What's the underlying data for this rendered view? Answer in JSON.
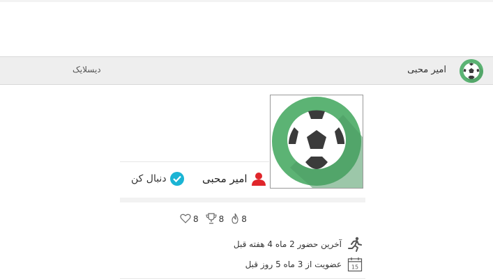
{
  "header": {
    "username": "امیر محبی",
    "dislike_label": "دیسلایک",
    "avatar_icon": "soccer-ball-icon"
  },
  "profile": {
    "name": "امیر محبی",
    "follow_label": "دنبال کن",
    "photo_icon": "soccer-ball-icon",
    "stats": {
      "likes": "8",
      "trophies": "8",
      "flames": "8"
    },
    "last_seen": "آخرین حضور 2 ماه 4 هفته قبل",
    "membership": "عضویت از 3 ماه 5 روز قبل",
    "calendar_day": "15"
  },
  "colors": {
    "ball_bg": "#5cb374",
    "user_icon": "#e0262b",
    "follow_check": "#1ab4d4"
  }
}
